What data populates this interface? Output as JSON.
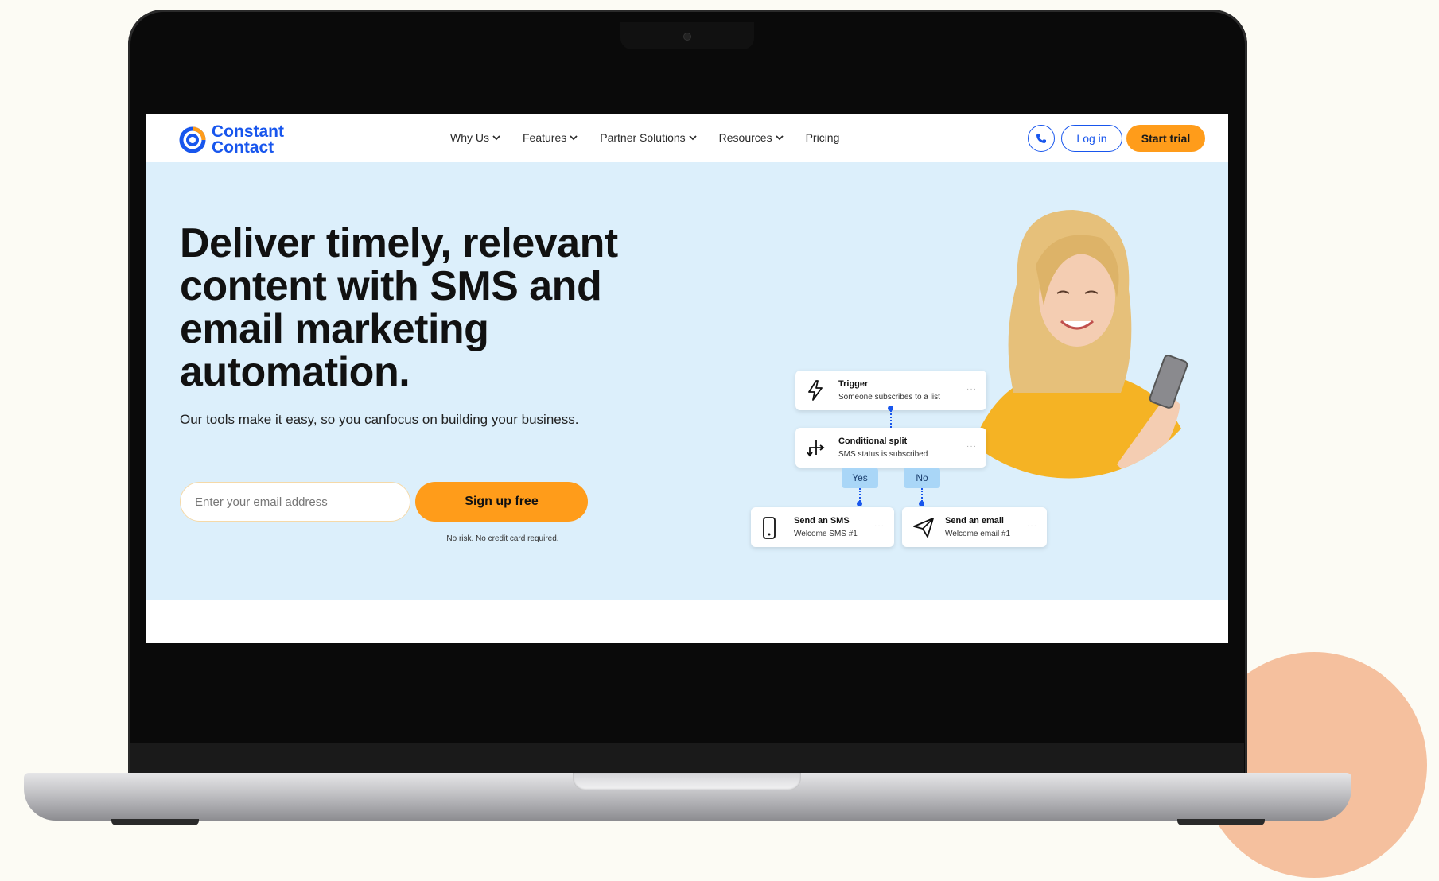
{
  "logo": {
    "line1": "Constant",
    "line2": "Contact"
  },
  "nav": {
    "items": [
      {
        "label": "Why Us",
        "has_dropdown": true
      },
      {
        "label": "Features",
        "has_dropdown": true
      },
      {
        "label": "Partner Solutions",
        "has_dropdown": true
      },
      {
        "label": "Resources",
        "has_dropdown": true
      },
      {
        "label": "Pricing",
        "has_dropdown": false
      }
    ],
    "phone_icon": "phone-icon",
    "login_label": "Log in",
    "trial_label": "Start trial"
  },
  "hero": {
    "headline": "Deliver timely, relevant content with SMS and email marketing automation.",
    "subtext": "Our tools make it easy, so you canfocus on building your business.",
    "email_placeholder": "Enter your email address",
    "signup_label": "Sign up free",
    "disclaimer": "No risk. No credit card required."
  },
  "workflow": {
    "trigger": {
      "title": "Trigger",
      "subtitle": "Someone subscribes to a list",
      "icon": "lightning-icon"
    },
    "split": {
      "title": "Conditional split",
      "subtitle": "SMS status is subscribed",
      "icon": "split-arrow-icon"
    },
    "yes_label": "Yes",
    "no_label": "No",
    "sms": {
      "title": "Send an SMS",
      "subtitle": "Welcome SMS #1",
      "icon": "phone-device-icon"
    },
    "email": {
      "title": "Send an email",
      "subtitle": "Welcome email #1",
      "icon": "paper-plane-icon"
    },
    "more": "···"
  },
  "colors": {
    "brand_blue": "#1856ed",
    "accent_orange": "#ff9c1a",
    "hero_bg": "#dceffb",
    "peach": "#f5c09e"
  }
}
